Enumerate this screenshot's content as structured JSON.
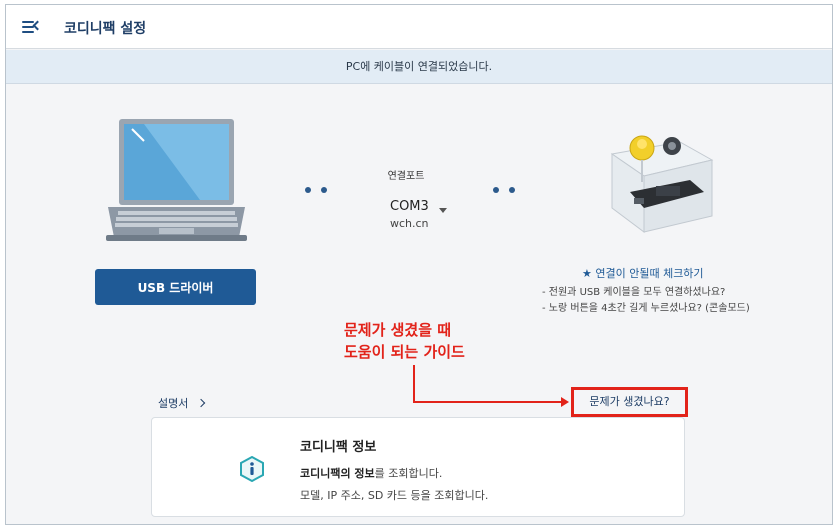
{
  "header": {
    "title": "코디니팩 설정",
    "menu_icon": "menu-collapse-icon"
  },
  "notice": {
    "text": "PC에 케이블이 연결되었습니다."
  },
  "usb_button": {
    "label": "USB 드라이버"
  },
  "port": {
    "label": "연결포트",
    "value": "COM3",
    "sub": "wch.cn"
  },
  "troubleshoot": {
    "title": "★ 연결이 안될때 체크하기",
    "items": [
      "- 전원과 USB 케이블을 모두 연결하셨나요?",
      "- 노랑 버튼을 4초간 길게 누르셨나요? (콘솔모드)"
    ]
  },
  "annotation": {
    "line1": "문제가 생겼을 때",
    "line2": "도움이 되는 가이드"
  },
  "links": {
    "manual": "설명서",
    "trouble": "문제가 생겼나요?"
  },
  "info_card": {
    "title": "코디니팩 정보",
    "line1_bold": "코디니팩의 정보",
    "line1_rest": "를 조회합니다.",
    "line2": "모델, IP 주소, SD 카드 등을 조회합니다."
  },
  "colors": {
    "primary": "#1f5a96",
    "annotation": "#e2231a",
    "banner": "#e2ecf5"
  }
}
